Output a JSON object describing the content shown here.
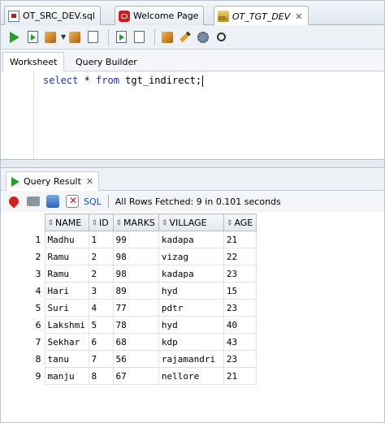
{
  "editor_tabs": [
    {
      "label": "OT_SRC_DEV.sql",
      "icon": "sql-file-icon"
    },
    {
      "label": "Welcome Page",
      "icon": "oracle-icon"
    },
    {
      "label": "OT_TGT_DEV",
      "icon": "connection-icon",
      "active": true
    }
  ],
  "worksheet_tabs": [
    {
      "label": "Worksheet",
      "active": true
    },
    {
      "label": "Query Builder"
    }
  ],
  "editor": {
    "keyword1": "select",
    "mid": " * ",
    "keyword2": "from",
    "rest": " tgt_indirect;"
  },
  "results": {
    "tab_label": "Query Result",
    "sql_link": "SQL",
    "status": "All Rows Fetched: 9 in 0.101 seconds",
    "columns": [
      "NAME",
      "ID",
      "MARKS",
      "VILLAGE",
      "AGE"
    ],
    "rows": [
      [
        "1",
        "Madhu",
        "1",
        "99",
        "kadapa",
        "21"
      ],
      [
        "2",
        "Ramu",
        "2",
        "98",
        "vizag",
        "22"
      ],
      [
        "3",
        "Ramu",
        "2",
        "98",
        "kadapa",
        "23"
      ],
      [
        "4",
        "Hari",
        "3",
        "89",
        "hyd",
        "15"
      ],
      [
        "5",
        "Suri",
        "4",
        "77",
        "pdtr",
        "23"
      ],
      [
        "6",
        "Lakshmi",
        "5",
        "78",
        "hyd",
        "40"
      ],
      [
        "7",
        "Sekhar",
        "6",
        "68",
        "kdp",
        "43"
      ],
      [
        "8",
        "tanu",
        "7",
        "56",
        "rajamandri",
        "23"
      ],
      [
        "9",
        "manju",
        "8",
        "67",
        "nellore",
        "21"
      ]
    ]
  }
}
